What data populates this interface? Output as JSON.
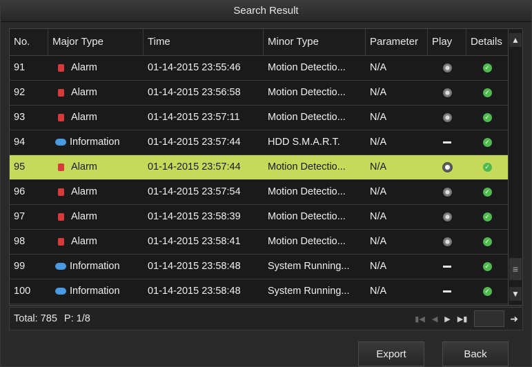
{
  "window": {
    "title": "Search Result"
  },
  "table": {
    "columns": [
      "No.",
      "Major Type",
      "Time",
      "Minor Type",
      "Parameter",
      "Play",
      "Details"
    ],
    "rows": [
      {
        "no": "91",
        "major": "Alarm",
        "major_icon": "alarm-icon",
        "time": "01-14-2015 23:55:46",
        "minor": "Motion Detectio...",
        "param": "N/A",
        "play": "play"
      },
      {
        "no": "92",
        "major": "Alarm",
        "major_icon": "alarm-icon",
        "time": "01-14-2015 23:56:58",
        "minor": "Motion Detectio...",
        "param": "N/A",
        "play": "play"
      },
      {
        "no": "93",
        "major": "Alarm",
        "major_icon": "alarm-icon",
        "time": "01-14-2015 23:57:11",
        "minor": "Motion Detectio...",
        "param": "N/A",
        "play": "play"
      },
      {
        "no": "94",
        "major": "Information",
        "major_icon": "info-icon",
        "time": "01-14-2015 23:57:44",
        "minor": "HDD S.M.A.R.T.",
        "param": "N/A",
        "play": "none"
      },
      {
        "no": "95",
        "major": "Alarm",
        "major_icon": "alarm-icon",
        "time": "01-14-2015 23:57:44",
        "minor": "Motion Detectio...",
        "param": "N/A",
        "play": "play",
        "selected": true
      },
      {
        "no": "96",
        "major": "Alarm",
        "major_icon": "alarm-icon",
        "time": "01-14-2015 23:57:54",
        "minor": "Motion Detectio...",
        "param": "N/A",
        "play": "play"
      },
      {
        "no": "97",
        "major": "Alarm",
        "major_icon": "alarm-icon",
        "time": "01-14-2015 23:58:39",
        "minor": "Motion Detectio...",
        "param": "N/A",
        "play": "play"
      },
      {
        "no": "98",
        "major": "Alarm",
        "major_icon": "alarm-icon",
        "time": "01-14-2015 23:58:41",
        "minor": "Motion Detectio...",
        "param": "N/A",
        "play": "play"
      },
      {
        "no": "99",
        "major": "Information",
        "major_icon": "info-icon",
        "time": "01-14-2015 23:58:48",
        "minor": "System Running...",
        "param": "N/A",
        "play": "none"
      },
      {
        "no": "100",
        "major": "Information",
        "major_icon": "info-icon",
        "time": "01-14-2015 23:58:48",
        "minor": "System Running...",
        "param": "N/A",
        "play": "none"
      }
    ]
  },
  "footer": {
    "total": "Total: 785",
    "page": "P: 1/8"
  },
  "buttons": {
    "export": "Export",
    "back": "Back"
  },
  "colors": {
    "selected_row": "#c5d95a",
    "alarm": "#d63a3a",
    "info": "#4a9be0",
    "check": "#4fb84f"
  }
}
